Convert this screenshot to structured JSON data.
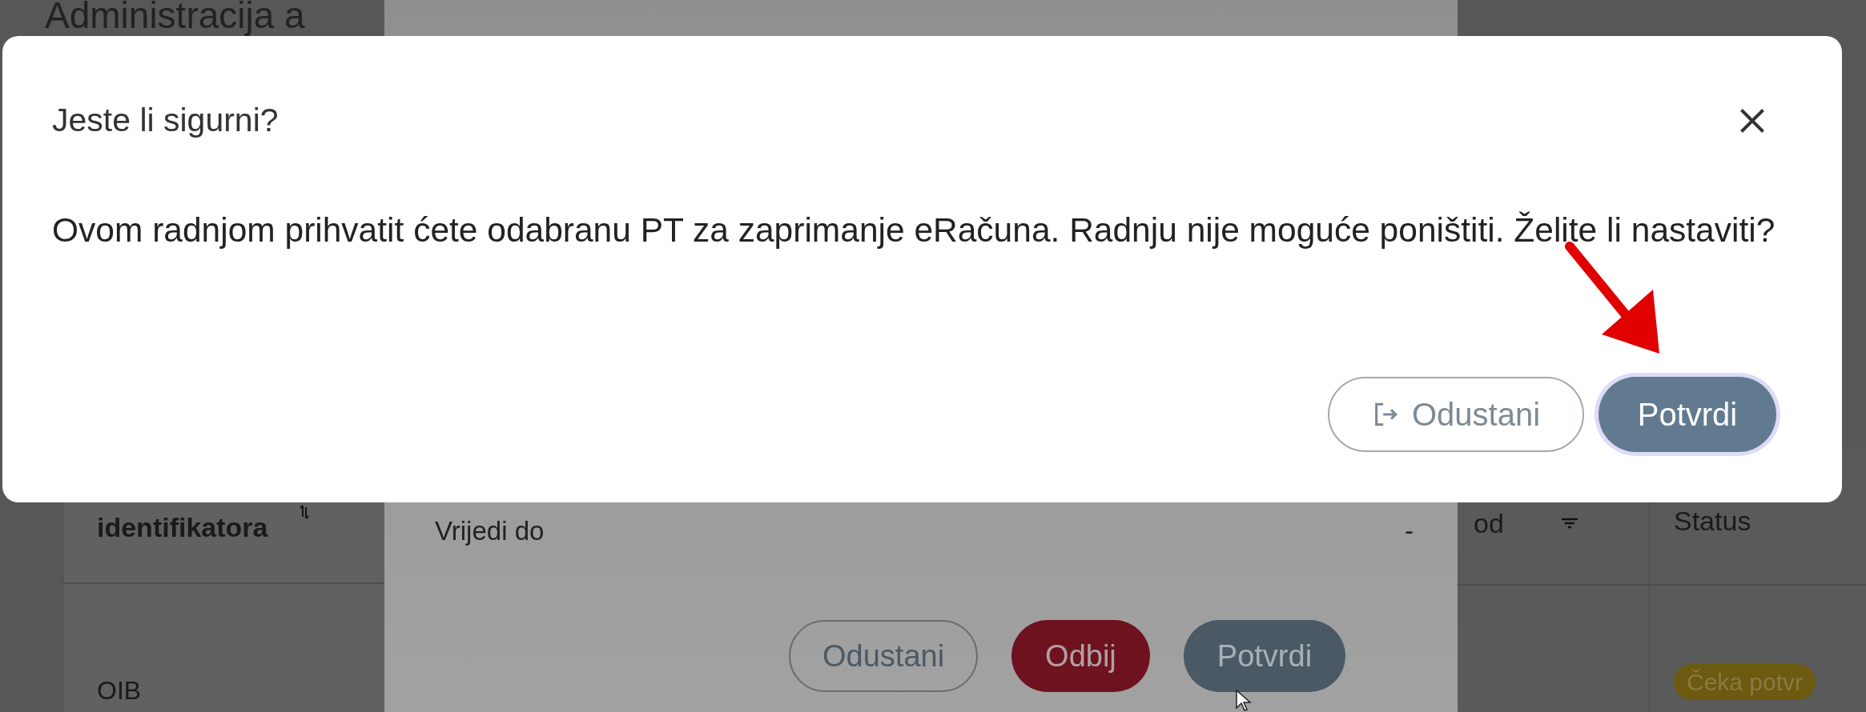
{
  "background_page": {
    "title": "Administracija a",
    "table_left": {
      "header": "identifikatora",
      "cell": "OIB"
    },
    "table_right": {
      "columns": [
        "od",
        "Status"
      ],
      "badge": "Čeka potvr"
    }
  },
  "background_dialog": {
    "field_label": "Vrijedi do",
    "field_value": "-",
    "buttons": [
      {
        "label": "Odustani",
        "kind": "outline"
      },
      {
        "label": "Odbij",
        "kind": "danger"
      },
      {
        "label": "Potvrdi",
        "kind": "primary"
      }
    ]
  },
  "dialog": {
    "title": "Jeste li sigurni?",
    "message": "Ovom radnjom prihvatit ćete odabranu PT za zaprimanje eRačuna. Radnju nije moguće poništiti. Želite li nastaviti?",
    "buttons": [
      {
        "label": "Odustani",
        "kind": "outline",
        "focused": false
      },
      {
        "label": "Potvrdi",
        "kind": "primary",
        "focused": true
      }
    ]
  }
}
